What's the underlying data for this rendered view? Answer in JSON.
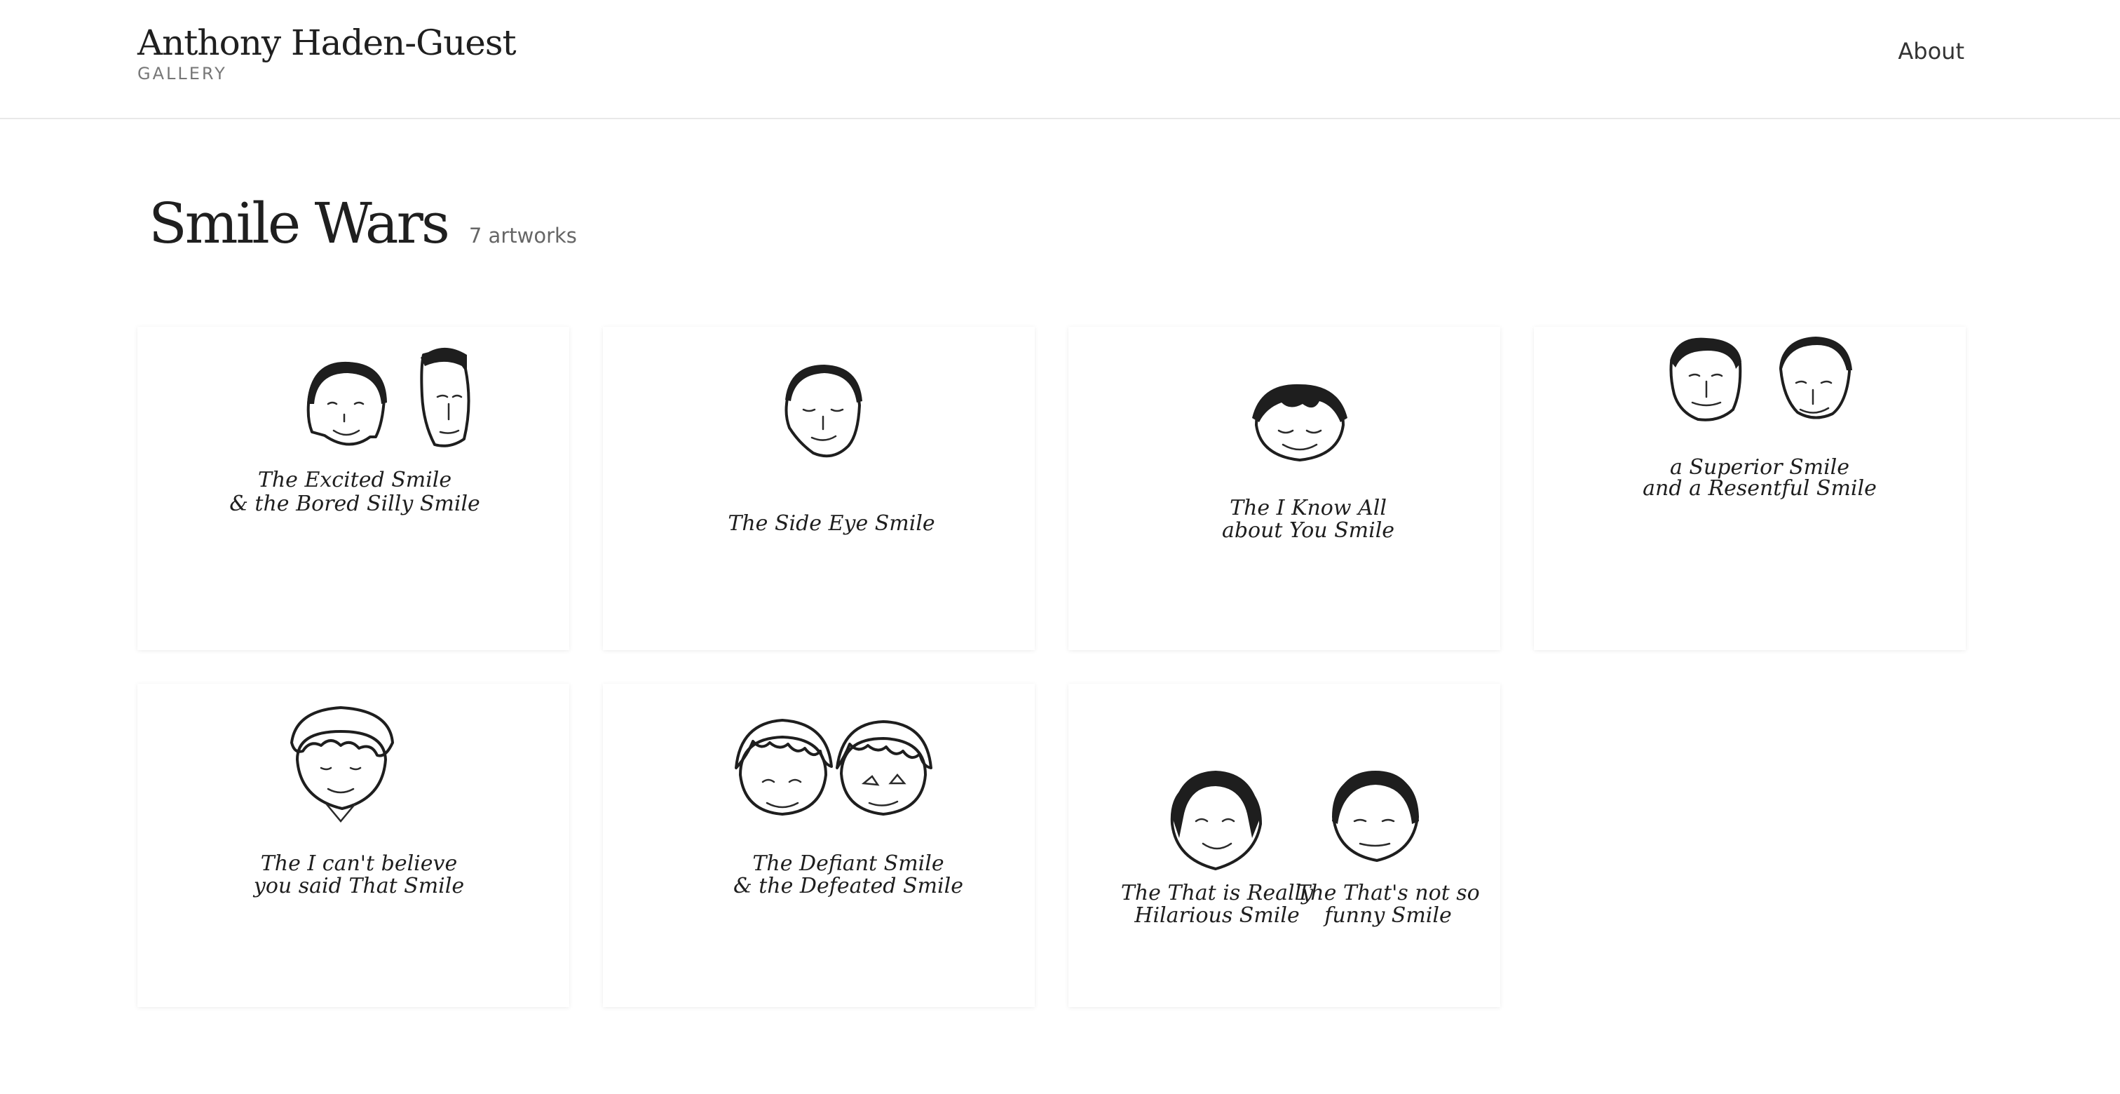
{
  "header": {
    "brand_name": "Anthony Haden-Guest",
    "brand_sub": "GALLERY",
    "nav_about": "About"
  },
  "collection": {
    "title": "Smile Wars",
    "count_text": "7 artworks"
  },
  "artworks": [
    {
      "caption_lines": [
        "The Excited Smile",
        "& the Bored Silly Smile"
      ]
    },
    {
      "caption_lines": [
        "The Side Eye Smile"
      ]
    },
    {
      "caption_lines": [
        "The I Know All",
        "about You Smile"
      ]
    },
    {
      "caption_lines": [
        "a Superior Smile",
        "and a Resentful Smile"
      ]
    },
    {
      "caption_lines": [
        "The I can't believe",
        "you said That Smile"
      ]
    },
    {
      "caption_lines": [
        "The Defiant Smile",
        "& the Defeated Smile"
      ]
    },
    {
      "caption_lines": [
        "The That is Really",
        "Hilarious Smile",
        "The That's not so",
        "funny Smile"
      ]
    }
  ]
}
